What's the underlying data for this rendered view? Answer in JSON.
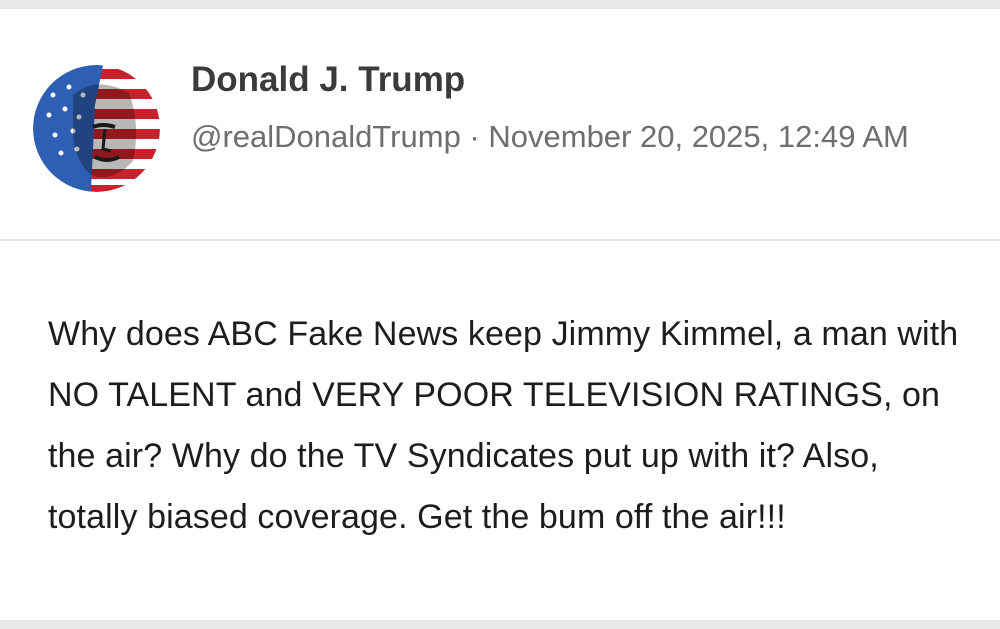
{
  "post": {
    "author": {
      "display_name": "Donald J. Trump",
      "handle": "@realDonaldTrump",
      "avatar_icon": "flag-portrait-avatar"
    },
    "separator": " · ",
    "timestamp": "November 20, 2025, 12:49 AM",
    "body": "Why does ABC Fake News keep Jimmy Kimmel, a man with NO TALENT and VERY POOR TELEVISION RATINGS, on the air? Why do the TV Syndicates put up with it? Also, totally biased coverage. Get the bum off the air!!!"
  },
  "colors": {
    "name": "#3b3b3b",
    "meta": "#6e6e6e",
    "text": "#1d1d1d",
    "divider": "#e6e6e6",
    "background": "#ffffff"
  }
}
